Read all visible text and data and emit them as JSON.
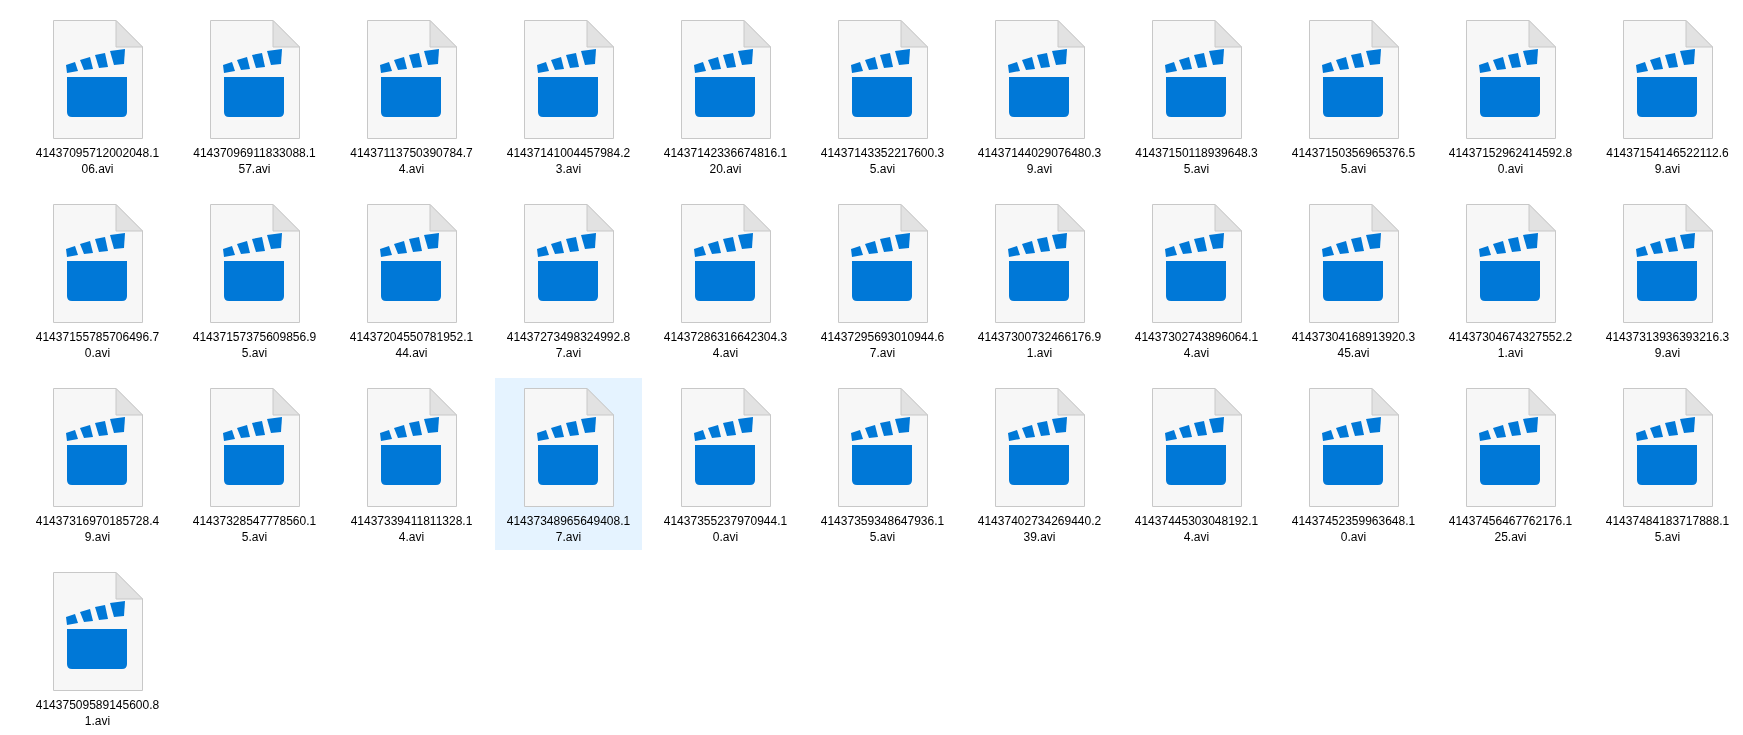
{
  "files": [
    {
      "name": "41437095712002048.106.avi",
      "selected": false
    },
    {
      "name": "41437096911833088.157.avi",
      "selected": false
    },
    {
      "name": "41437113750390784.74.avi",
      "selected": false
    },
    {
      "name": "41437141004457984.23.avi",
      "selected": false
    },
    {
      "name": "41437142336674816.120.avi",
      "selected": false
    },
    {
      "name": "41437143352217600.35.avi",
      "selected": false
    },
    {
      "name": "41437144029076480.39.avi",
      "selected": false
    },
    {
      "name": "41437150118939648.35.avi",
      "selected": false
    },
    {
      "name": "41437150356965376.55.avi",
      "selected": false
    },
    {
      "name": "41437152962414592.80.avi",
      "selected": false
    },
    {
      "name": "41437154146522112.69.avi",
      "selected": false
    },
    {
      "name": "41437155785706496.70.avi",
      "selected": false
    },
    {
      "name": "41437157375609856.95.avi",
      "selected": false
    },
    {
      "name": "41437204550781952.144.avi",
      "selected": false
    },
    {
      "name": "41437273498324992.87.avi",
      "selected": false
    },
    {
      "name": "41437286316642304.34.avi",
      "selected": false
    },
    {
      "name": "41437295693010944.67.avi",
      "selected": false
    },
    {
      "name": "41437300732466176.91.avi",
      "selected": false
    },
    {
      "name": "41437302743896064.14.avi",
      "selected": false
    },
    {
      "name": "41437304168913920.345.avi",
      "selected": false
    },
    {
      "name": "41437304674327552.21.avi",
      "selected": false
    },
    {
      "name": "41437313936393216.39.avi",
      "selected": false
    },
    {
      "name": "41437316970185728.49.avi",
      "selected": false
    },
    {
      "name": "41437328547778560.15.avi",
      "selected": false
    },
    {
      "name": "41437339411811328.14.avi",
      "selected": false
    },
    {
      "name": "41437348965649408.17.avi",
      "selected": true
    },
    {
      "name": "41437355237970944.10.avi",
      "selected": false
    },
    {
      "name": "41437359348647936.15.avi",
      "selected": false
    },
    {
      "name": "41437402734269440.239.avi",
      "selected": false
    },
    {
      "name": "41437445303048192.14.avi",
      "selected": false
    },
    {
      "name": "41437452359963648.10.avi",
      "selected": false
    },
    {
      "name": "41437456467762176.125.avi",
      "selected": false
    },
    {
      "name": "41437484183717888.15.avi",
      "selected": false
    },
    {
      "name": "41437509589145600.81.avi",
      "selected": false
    }
  ]
}
